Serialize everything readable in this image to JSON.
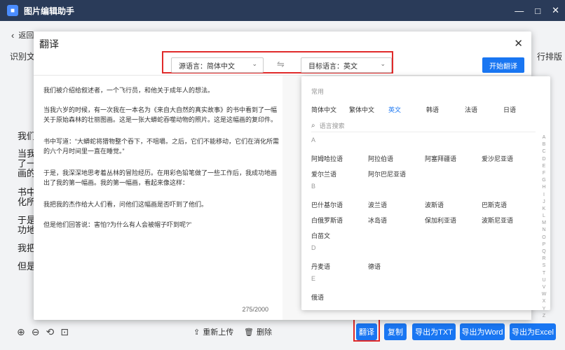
{
  "app": {
    "title": "图片编辑助手",
    "logo_glyph": "■",
    "minimize": "—",
    "maximize": "□",
    "close": "✕"
  },
  "background": {
    "back_label": "返回",
    "left_label": "识别文",
    "right_label": "行排版",
    "fragments": [
      "我们",
      "当我",
      "了一",
      "画的",
      "书中",
      "化所",
      "于是",
      "功地",
      "我把",
      "但是"
    ]
  },
  "bottom": {
    "zoom_in": "⊕",
    "zoom_out": "⊖",
    "rotate": "⟲",
    "fit": "⊡",
    "reupload_icon": "⇪",
    "reupload": "重新上传",
    "delete_icon": "🗑",
    "delete": "删除",
    "translate": "翻译",
    "copy": "复制",
    "export_txt": "导出为TXT",
    "export_word": "导出为Word",
    "export_excel": "导出为Excel",
    "accent": "#1976f2"
  },
  "modal": {
    "title": "翻译",
    "close": "✕",
    "source_lang": "源语言：简体中文",
    "target_lang": "目标语言：英文",
    "swap": "⇋",
    "start": "开始翻译",
    "source_text": [
      "我们被介绍给叙述者，一个飞行员，和他关于成年人的想法。",
      "当我六岁的时候，有一次我在一本名为《来自大自然的真实故事》的书中看到了一幅关于原始森林的壮丽图画。这是一张大蟒蛇吞噬动物的照片。这是这幅画的复印件。",
      "书中写道：“大蟒蛇将猎物整个吞下，不咀嚼。之后，它们不能移动，它们在消化所需的六个月时间里一直在睡觉。”",
      "于是，我深深地思考着丛林的冒险经历。在用彩色铅笔做了一些工作后，我成功地画出了我的第一幅画。我的第一幅画，看起来像这样：",
      "我把我的杰作给大人们看，问他们这幅画是否吓到了他们。",
      "但是他们回答说：害怕?为什么有人会被帽子吓到呢?”"
    ],
    "char_count": "275/2000"
  },
  "dropdown": {
    "common_label": "常用",
    "common": [
      "简体中文",
      "繁体中文",
      "英文",
      "韩语",
      "法语",
      "日语"
    ],
    "search_placeholder": "语言搜索",
    "search_icon": "⌕",
    "groups": [
      {
        "letter": "A",
        "items": [
          "阿姆哈拉语",
          "阿拉伯语",
          "阿塞拜疆语",
          "爱沙尼亚语",
          "爱尔兰语",
          "阿尔巴尼亚语"
        ]
      },
      {
        "letter": "B",
        "items": [
          "巴什基尔语",
          "波兰语",
          "波斯语",
          "巴斯克语",
          "白俄罗斯语",
          "冰岛语",
          "保加利亚语",
          "波斯尼亚语",
          "白苗文"
        ]
      },
      {
        "letter": "D",
        "items": [
          "丹麦语",
          "德语"
        ]
      },
      {
        "letter": "E",
        "items": [
          "俄语"
        ]
      }
    ],
    "alpha": [
      "A",
      "B",
      "C",
      "D",
      "E",
      "F",
      "G",
      "H",
      "I",
      "J",
      "K",
      "L",
      "M",
      "N",
      "O",
      "P",
      "Q",
      "R",
      "S",
      "T",
      "U",
      "V",
      "W",
      "X",
      "Y",
      "Z"
    ]
  }
}
